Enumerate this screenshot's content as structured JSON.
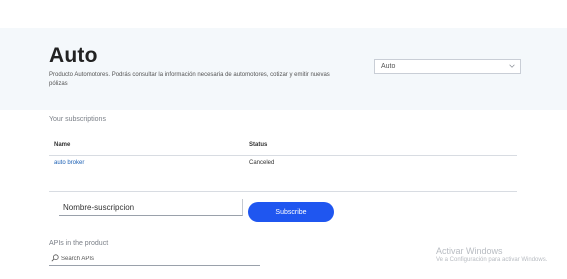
{
  "hero": {
    "title": "Auto",
    "description": "Producto Automotores. Podrás consultar la información necesaria de automotores, cotizar y emitir nuevas pólizas",
    "select_value": "Auto"
  },
  "subscriptions": {
    "section_label": "Your subscriptions",
    "columns": [
      "Name",
      "Status"
    ],
    "rows": [
      {
        "name": "auto broker",
        "status": "Canceled"
      }
    ]
  },
  "subscribe_form": {
    "name_placeholder": "Nombre-suscripcion",
    "button_label": "Subscribe"
  },
  "apis": {
    "section_label": "APIs in the product",
    "search_placeholder": "Search APIs"
  },
  "watermark": {
    "title": "Activar Windows",
    "subtitle": "Ve a Configuración para activar Windows."
  }
}
